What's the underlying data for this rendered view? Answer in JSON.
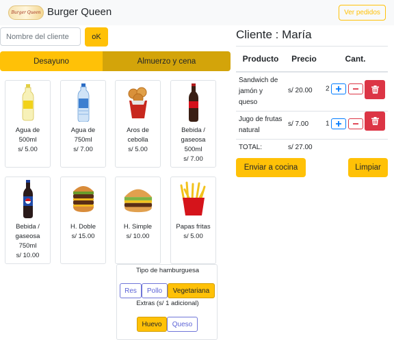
{
  "navbar": {
    "logo_text": "Burger Queen",
    "brand": "Burger Queen",
    "orders_button": "Ver pedidos"
  },
  "customer": {
    "name_placeholder": "Nombre del cliente",
    "ok_button": "oK"
  },
  "tabs": [
    {
      "label": "Desayuno",
      "active": true
    },
    {
      "label": "Almuerzo y cena",
      "active": false
    }
  ],
  "products": [
    {
      "name": "Agua de 500ml",
      "price": "s/ 5.00",
      "icon": "water-500ml-bottle-icon"
    },
    {
      "name": "Agua de 750ml",
      "price": "s/ 7.00",
      "icon": "water-750ml-bottle-icon"
    },
    {
      "name": "Aros de cebolla",
      "price": "s/ 5.00",
      "icon": "onion-rings-icon"
    },
    {
      "name": "Bebida / gaseosa 500ml",
      "price": "s/ 7.00",
      "icon": "cola-bottle-icon"
    },
    {
      "name": "Bebida / gaseosa 750ml",
      "price": "s/ 10.00",
      "icon": "pepsi-bottle-icon"
    },
    {
      "name": "H. Doble",
      "price": "s/ 15.00",
      "icon": "double-burger-icon"
    },
    {
      "name": "H. Simple",
      "price": "s/ 10.00",
      "icon": "simple-burger-icon"
    },
    {
      "name": "Papas fritas",
      "price": "s/ 5.00",
      "icon": "french-fries-icon"
    }
  ],
  "burger_options": {
    "type_label": "Tipo de hamburguesa",
    "types": [
      {
        "label": "Res",
        "active": false
      },
      {
        "label": "Pollo",
        "active": false
      },
      {
        "label": "Vegetariana",
        "active": true
      }
    ],
    "extras_label": "Extras (s/ 1 adicional)",
    "extras": [
      {
        "label": "Huevo",
        "active": true
      },
      {
        "label": "Queso",
        "active": false
      }
    ]
  },
  "order": {
    "client_title": "Cliente : María",
    "columns": [
      "Producto",
      "Precio",
      "Cant."
    ],
    "items": [
      {
        "product": "Sandwich de jamón y queso",
        "price": "s/ 20.00",
        "qty": "2"
      },
      {
        "product": "Jugo de frutas natural",
        "price": "s/ 7.00",
        "qty": "1"
      }
    ],
    "total_label": "TOTAL:",
    "total_value": "s/ 27.00",
    "send_button": "Enviar a cocina",
    "clear_button": "Limpiar"
  },
  "colors": {
    "accent": "#ffc107",
    "accent_dark": "#d3a40a",
    "danger": "#dc3545",
    "primary": "#007bff",
    "navbar_bg": "#f8f9fa"
  }
}
